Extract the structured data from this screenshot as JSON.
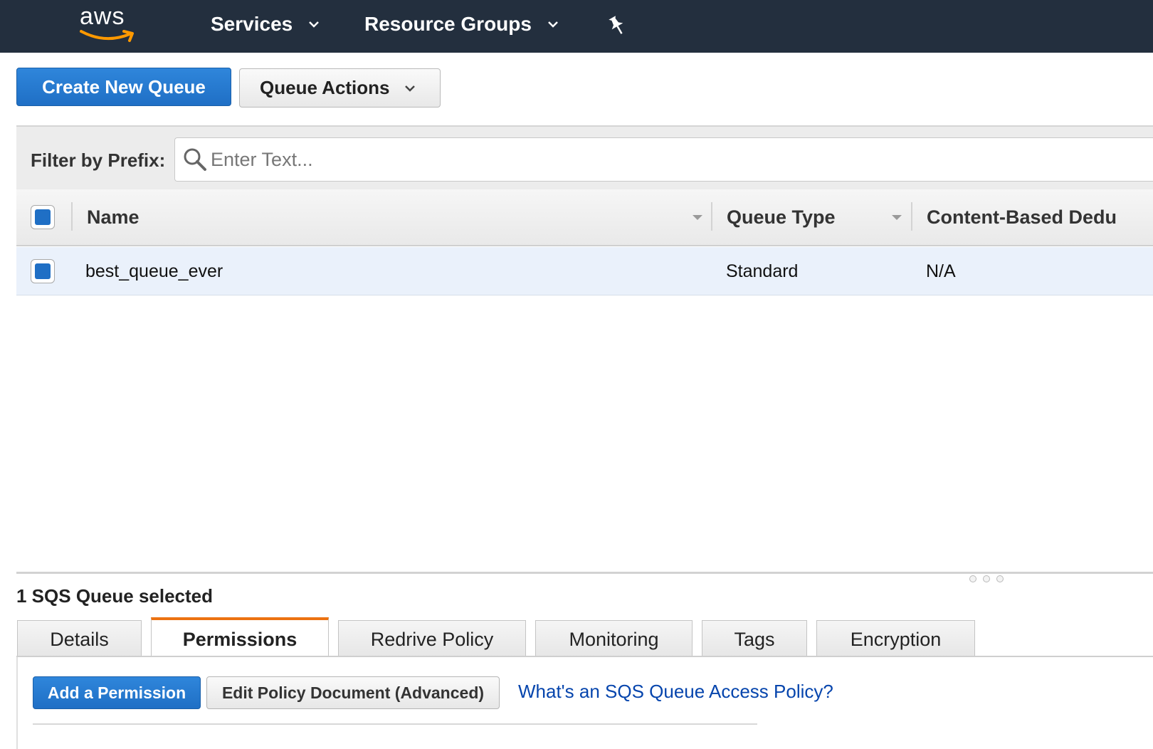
{
  "topnav": {
    "logo_text": "aws",
    "logo_smile_color": "#ff9900",
    "bg_color": "#232f3e",
    "items": [
      {
        "label": "Services",
        "icon": "chevron-down-icon"
      },
      {
        "label": "Resource Groups",
        "icon": "chevron-down-icon"
      }
    ],
    "pin_icon": "pin-icon"
  },
  "toolbar": {
    "create_label": "Create New Queue",
    "actions_label": "Queue Actions",
    "primary_color": "#1f6fc5"
  },
  "filter": {
    "label": "Filter by Prefix:",
    "placeholder": "Enter Text...",
    "value": "",
    "icon": "search-icon"
  },
  "table": {
    "columns": [
      "Name",
      "Queue Type",
      "Content-Based Dedu"
    ],
    "rows": [
      {
        "selected": true,
        "name": "best_queue_ever",
        "queue_type": "Standard",
        "content_dedup": "N/A"
      }
    ]
  },
  "details": {
    "selected_count": "1 SQS Queue selected",
    "tabs": [
      "Details",
      "Permissions",
      "Redrive Policy",
      "Monitoring",
      "Tags",
      "Encryption"
    ],
    "active_tab": "Permissions",
    "active_tab_color": "#ec7211",
    "add_permission_label": "Add a Permission",
    "edit_policy_label": "Edit Policy Document (Advanced)",
    "help_link": "What's an SQS Queue Access Policy?"
  }
}
